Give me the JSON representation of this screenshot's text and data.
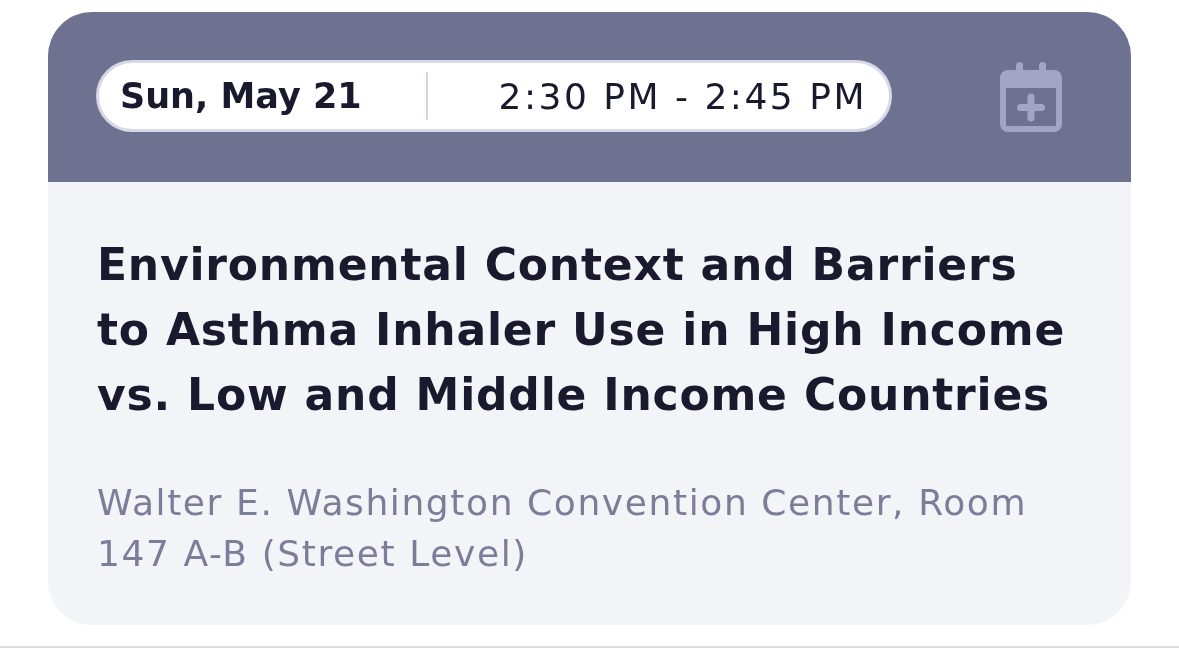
{
  "session": {
    "date": "Sun, May 21",
    "time": "2:30 PM - 2:45 PM",
    "title": "Environmental Context and Barriers to Asthma Inhaler Use in High Income vs. Low and Middle Income Countries",
    "location": "Walter E. Washington Convention Center, Room 147 A-B (Street Level)"
  }
}
